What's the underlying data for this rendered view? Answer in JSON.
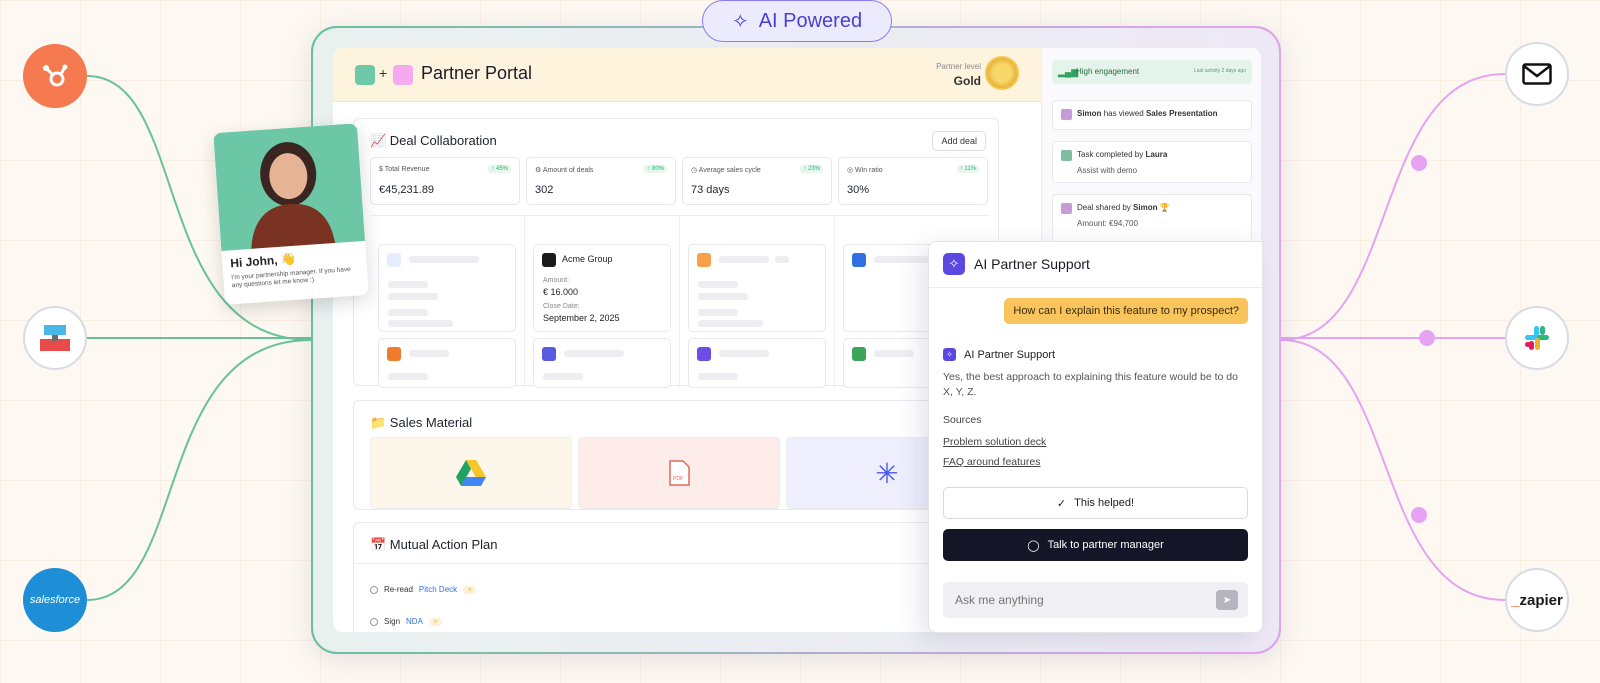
{
  "badge": {
    "label": "AI Powered"
  },
  "integrations": {
    "left": [
      "hubspot-icon",
      "app-icon",
      "salesforce-icon"
    ],
    "right": [
      "mail-icon",
      "slack-icon",
      "zapier-icon"
    ],
    "salesforce_label": "salesforce",
    "zapier_label": "zapier"
  },
  "colors": {
    "accent": "#5b48e0",
    "green": "#68c19c",
    "pink": "#e6a2f3"
  },
  "person": {
    "greeting": "Hi John, 👋",
    "message": "I'm your partnership manager. If you have any questions let me know :)"
  },
  "header": {
    "title": "Partner Portal",
    "partner_level_label": "Partner level",
    "partner_level_value": "Gold"
  },
  "deals": {
    "title": "📈 Deal Collaboration",
    "add_label": "Add deal",
    "metrics": [
      {
        "label": "$ Total Revenue",
        "change": "↑ 45%",
        "value": "€45,231.89"
      },
      {
        "label": "⚙ Amount of deals",
        "change": "↑ 80%",
        "value": "302"
      },
      {
        "label": "◷ Average sales cycle",
        "change": "↑ 23%",
        "value": "73 days"
      },
      {
        "label": "◎ Win ratio",
        "change": "↑ 11%",
        "value": "30%"
      }
    ],
    "acme": {
      "name": "Acme Group",
      "amount_label": "Amount:",
      "amount": "€ 16.000",
      "close_label": "Close Date:",
      "close": "September 2, 2025"
    }
  },
  "sales": {
    "title": "📁 Sales Material"
  },
  "map": {
    "title": "📅 Mutual Action Plan",
    "tasks": [
      {
        "prefix": "Re-read",
        "link": "Pitch Deck",
        "chip": "»"
      },
      {
        "prefix": "Sign",
        "link": "NDA",
        "chip": "»"
      }
    ]
  },
  "activity": {
    "engagement": "High engagement",
    "last_activity": "Last activity 2 days ago",
    "items": [
      {
        "actor": "Simon",
        "text": "has viewed",
        "object": "Sales Presentation"
      },
      {
        "text": "Task completed by",
        "actor": "Laura",
        "sub": "Assist with demo"
      },
      {
        "text": "Deal shared by",
        "actor": "Simon 🏆",
        "sub": "Amount: €94,700"
      }
    ]
  },
  "chat": {
    "title": "AI Partner Support",
    "user_message": "How can I explain this feature to my prospect?",
    "bot_name": "AI Partner Support",
    "bot_message": "Yes, the best approach to explaining this feature would be to do X, Y, Z.",
    "sources_label": "Sources",
    "sources": [
      "Problem solution deck",
      "FAQ around features"
    ],
    "helped_label": "This helped!",
    "talk_label": "Talk to partner manager",
    "input_placeholder": "Ask me anything"
  }
}
